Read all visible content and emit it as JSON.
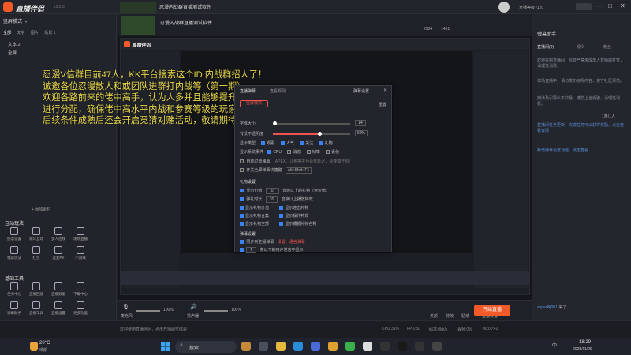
{
  "app": {
    "title": "直播伴侣",
    "version": "v3.5.3",
    "stream_title": "忍漫内战群直播测试软件",
    "scene_mode": "竖屏模式",
    "user_level": "开播等级 /120",
    "stats": {
      "a": "2934",
      "b": "1451"
    },
    "window_btns": [
      "—",
      "□",
      "✕"
    ]
  },
  "sidebar": {
    "scene_tabs": [
      "场景1",
      "场景2"
    ],
    "source_tabs": [
      "全部",
      "文字",
      "图片",
      "场景 1"
    ],
    "sources": [
      "文本 2",
      "全屏"
    ],
    "add_source": "+ 添加素材",
    "interact_title": "互动玩法",
    "interact_tools": [
      "投票设置",
      "观众互动",
      "多人连线",
      "现场直播",
      "福袋玩法",
      "红包",
      "连麦PK",
      "小游戏",
      "贴纸",
      "麦序",
      "抽奖",
      "弹幕互动"
    ],
    "basic_title": "基础工具",
    "basic_tools": [
      "任务中心",
      "直播回放",
      "直播数据",
      "下载中心",
      "弹幕助手",
      "直播工具",
      "直播设置",
      "更多功能"
    ]
  },
  "overlay": {
    "lines": [
      "忍漫V信群目前47人，KK平台搜索这个ID 内战群招人了！",
      "诚邀各位忍漫散人和或团队进群打内战等（第一期）",
      "欢迎各路前来的佬中高手，认为人多并且能够提升水平！",
      "进行分配，确保佬中高水平内战和参赛等级的玩家们可以一起",
      "后续条件成熟后还会开启竞猜对赌活动，敬请期待！"
    ]
  },
  "dialog": {
    "title": "弹幕设置",
    "tab_active": "直播弹幕",
    "tab_other": "查看规则",
    "mode_btn": "竖屏模式",
    "reset": "重置",
    "rows": {
      "font_size": "字体大小",
      "font_size_val": "14",
      "opacity": "背景不透明度",
      "opacity_val": "60%",
      "show_types": "显示类型",
      "types": [
        "观看",
        "人气",
        "关注",
        "礼物",
        "点赞",
        "分享"
      ],
      "show_system": "显示系统事件",
      "system": [
        "CPU",
        "消息",
        "帧率",
        "丢帧"
      ],
      "auto_filter": "自动过滤弹幕",
      "auto_filter_note": "（APEX、斗鱼等平台会有延迟，请谨慎开启）",
      "hotkey": "开关全屏弹幕快捷键",
      "hotkey_val": "Alt+Shift+F1",
      "section2": "礼物设置",
      "gift_min": "显示价值",
      "gift_min_val": "0",
      "gift_min_note": "音浪以上的礼物（含价值）",
      "gift_delay": "弹礼时长",
      "gift_delay_val": "30",
      "gift_delay_note": "音浪以上播放特效",
      "gift_opts": [
        "显示礼物价值",
        "显示礼物合集",
        "显示礼物全部",
        "显示连击礼物",
        "显示操作特效",
        "显示播报礼物名称"
      ],
      "section3": "弹幕设置",
      "bottom_opt": "同步到主播弹幕",
      "bottom_link": "设置：语言弹幕",
      "bottom_num": "1",
      "bottom_note": "条以下的用户发言不显示"
    }
  },
  "rightpanel": {
    "title": "弹幕助手",
    "tabs": [
      "直播间(0)",
      "观众",
      "粉丝"
    ],
    "messages": [
      "欢迎来到直播间！抖音严禁未成年人直播或打赏，请理性消费。",
      "本场直播中，请勿发布违规内容，遵守社区规范。",
      "如涉及引导私下交易，谨防上当受骗，请理性消费。"
    ],
    "count_label": "1条/1人",
    "notice1": "直播间任务更新：完成任务可以获得奖励，点击查看详情",
    "notice2": "新增弹幕设置功能，点击查看",
    "user1": "super啊001",
    "user1_action": "来了",
    "user2": "super啊001",
    "user2_action": "刷啊77",
    "input_placeholder": "说点什么..."
  },
  "bottombar": {
    "mic": "麦克风",
    "mic_val": "100%",
    "speaker": "扬声器",
    "speaker_val": "100%",
    "tools": [
      "美颜",
      "特效",
      "贴纸",
      "直播设置"
    ],
    "live_btn": "开始直播"
  },
  "status": {
    "text": "欢迎使用直播伴侣，点击开播即可体验",
    "cpu": "CPU:31%",
    "fps": "FPS:30",
    "bitrate": "码率:0kb/s",
    "drop": "丢帧:0%",
    "time": "00:00:42"
  },
  "taskbar": {
    "weather_temp": "20°C",
    "weather_desc": "晴朗",
    "search": "搜索",
    "time": "18:29",
    "date": "2025/11/29",
    "lang": "中"
  },
  "colors": {
    "accent": "#f35a2a",
    "overlay_text": "#e8d84a",
    "checkbox": "#3b82f6"
  }
}
